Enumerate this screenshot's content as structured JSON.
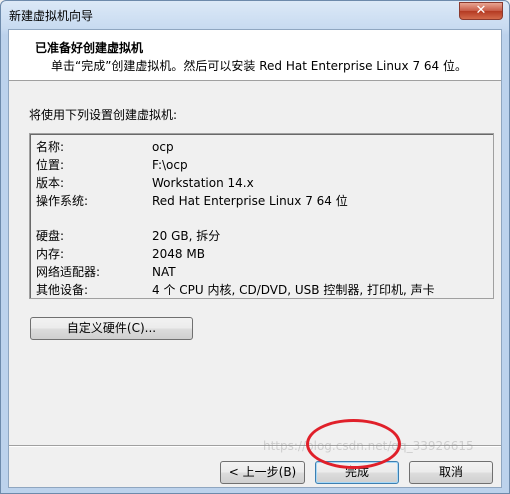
{
  "window": {
    "title": "新建虚拟机向导",
    "close_label": "✕"
  },
  "header": {
    "title": "已准备好创建虚拟机",
    "subtitle": "单击“完成”创建虚拟机。然后可以安装 Red Hat Enterprise Linux 7 64 位。"
  },
  "summary": {
    "label": "将使用下列设置创建虚拟机:",
    "group1": [
      {
        "key": "名称:",
        "value": "ocp"
      },
      {
        "key": "位置:",
        "value": "F:\\ocp"
      },
      {
        "key": "版本:",
        "value": "Workstation 14.x"
      },
      {
        "key": "操作系统:",
        "value": "Red Hat Enterprise Linux 7 64 位"
      }
    ],
    "group2": [
      {
        "key": "硬盘:",
        "value": "20 GB, 拆分"
      },
      {
        "key": "内存:",
        "value": "2048 MB"
      },
      {
        "key": "网络适配器:",
        "value": "NAT"
      },
      {
        "key": "其他设备:",
        "value": "4 个 CPU 内核, CD/DVD, USB 控制器, 打印机, 声卡"
      }
    ]
  },
  "buttons": {
    "customize": "自定义硬件(C)...",
    "back": "< 上一步(B)",
    "finish": "完成",
    "cancel": "取消"
  },
  "watermark": "https://blog.csdn.net/qq_33926615",
  "colors": {
    "annotation_circle": "#e0202a"
  }
}
